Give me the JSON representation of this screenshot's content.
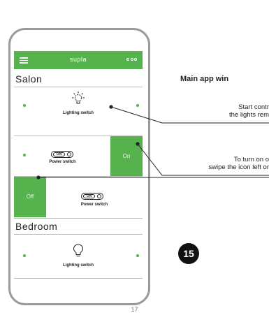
{
  "app": {
    "title": "supla",
    "menu_icon": "hamburger-icon",
    "more_icon": "more-options-icon"
  },
  "sections": [
    {
      "title": "Salon",
      "channels": [
        {
          "label": "Lighting switch",
          "icon": "lightbulb-on-icon"
        },
        {
          "label": "Power switch",
          "icon": "toggle-switch-icon",
          "swipe_label": "On"
        },
        {
          "label": "Power switch",
          "icon": "toggle-switch-icon",
          "swipe_label": "Off"
        }
      ]
    },
    {
      "title": "Bedroom",
      "channels": [
        {
          "label": "Lighting switch",
          "icon": "lightbulb-off-icon"
        }
      ]
    }
  ],
  "toggle_text": "ON",
  "callouts": {
    "title": "Main app win",
    "start": [
      "Start contr",
      "the lights rem"
    ],
    "turn": [
      "To turn on o",
      "swipe the icon left or"
    ]
  },
  "step_number": "15",
  "page_number": "17",
  "colors": {
    "accent": "#55b24d",
    "phone_border": "#9a9a9a"
  }
}
